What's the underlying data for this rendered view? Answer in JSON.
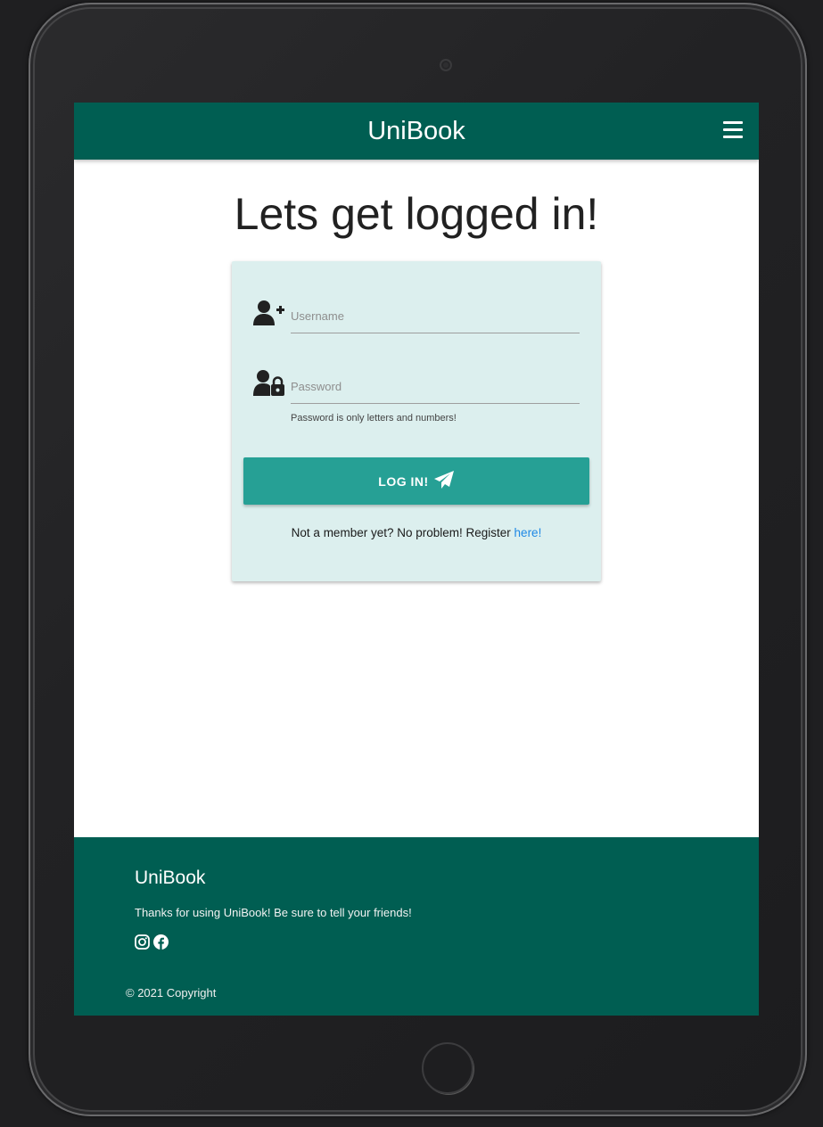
{
  "navbar": {
    "brand": "UniBook",
    "menu_icon": "hamburger-menu-icon"
  },
  "main": {
    "title": "Lets get logged in!"
  },
  "login_form": {
    "username": {
      "icon": "user-plus-icon",
      "placeholder": "Username",
      "value": ""
    },
    "password": {
      "icon": "user-lock-icon",
      "placeholder": "Password",
      "value": "",
      "helper": "Password is only letters and numbers!"
    },
    "submit": {
      "label": "LOG IN!",
      "icon": "paper-plane-icon"
    },
    "register_prompt": "Not a member yet? No problem! Register",
    "register_link": "here!"
  },
  "footer": {
    "title": "UniBook",
    "text": "Thanks for using UniBook! Be sure to tell your friends!",
    "social_icons": [
      "instagram-icon",
      "facebook-icon"
    ],
    "copyright": "© 2021 Copyright"
  },
  "colors": {
    "primary": "#005e52",
    "button": "#26a095",
    "card": "#dcefee",
    "link": "#1e88e5"
  }
}
